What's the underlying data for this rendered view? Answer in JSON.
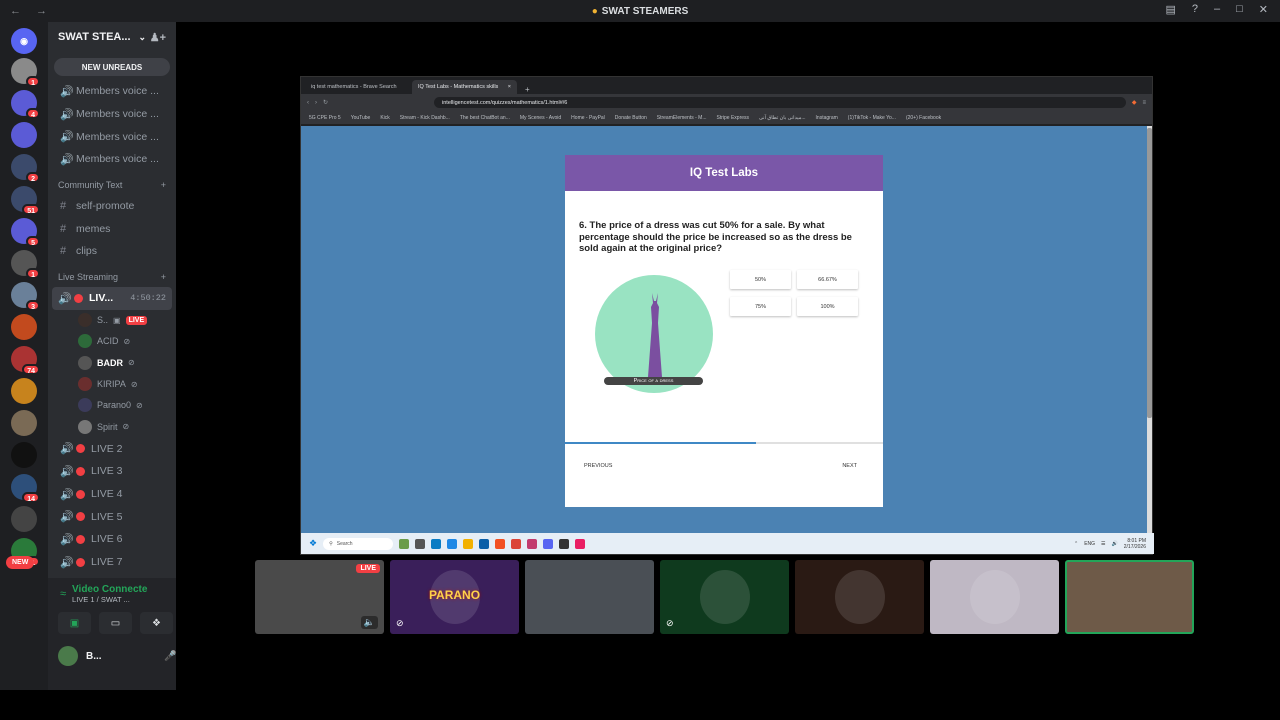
{
  "titlebar": {
    "title": "SWAT STEAMERS",
    "nav": "← →",
    "ctrl_min": "–",
    "ctrl_max": "□",
    "ctrl_close": "✕"
  },
  "servers": {
    "items": [
      {
        "badge": "1",
        "color": "#8a8a8a"
      },
      {
        "badge": "4",
        "color": "#5b5bd6"
      },
      {
        "badge": "",
        "color": "#5b5bd6"
      },
      {
        "badge": "2",
        "color": "#3b4a6b"
      },
      {
        "badge": "51",
        "color": "#3b4a6b"
      },
      {
        "badge": "5",
        "color": "#5b5bd6"
      },
      {
        "badge": "1",
        "color": "#555"
      },
      {
        "badge": "3",
        "color": "#6a8099"
      },
      {
        "badge": "",
        "color": "#c24a1e"
      },
      {
        "badge": "74",
        "color": "#a33"
      },
      {
        "badge": "",
        "color": "#c7831d"
      },
      {
        "badge": "",
        "color": "#7a6a55"
      },
      {
        "badge": "",
        "color": "#111"
      },
      {
        "badge": "14",
        "color": "#2d4f7a"
      },
      {
        "badge": "",
        "color": "#444"
      },
      {
        "badge": "11",
        "color": "#2a7a3a"
      }
    ],
    "new_label": "NEW"
  },
  "sidebar": {
    "guild_name": "SWAT STEA...",
    "new_unreads": "NEW UNREADS",
    "voice_channels_top": [
      "Members voice ...",
      "Members voice ...",
      "Members voice ...",
      "Members voice ..."
    ],
    "category_text": "Community Text",
    "text_channels": [
      "self-promote",
      "memes",
      "clips"
    ],
    "category_live": "Live Streaming",
    "active_channel": {
      "name": "LIV...",
      "time": "4:50:22"
    },
    "users": [
      {
        "name": "S..",
        "live": "LIVE"
      },
      {
        "name": "ACID"
      },
      {
        "name": "BADR"
      },
      {
        "name": "KIRIPA"
      },
      {
        "name": "Parano0"
      },
      {
        "name": "Spirit"
      }
    ],
    "live_channels": [
      "LIVE 2",
      "LIVE 3",
      "LIVE 4",
      "LIVE 5",
      "LIVE 6",
      "LIVE 7"
    ]
  },
  "voice_panel": {
    "title": "Video Connecte",
    "subtitle": "LIVE 1 / SWAT ...",
    "user": "B..."
  },
  "browser": {
    "tabs": [
      {
        "label": "iq test mathematics - Brave Search"
      },
      {
        "label": "IQ Test Labs - Mathematics skills"
      }
    ],
    "url": "intelligencetest.com/quizzes/mathematics/1.html#/6",
    "bookmarks": [
      "5G CPE Pro 5",
      "YouTube",
      "Kick",
      "Stream - Kick Dashb...",
      "The best ChatBot an...",
      "My Scenes - Avoid",
      "Home - PayPal",
      "Donate Button",
      "StreamElements - M...",
      "Stripe Express",
      "میدانی بان تطاق آنی...",
      "Instagram",
      "(1)TikTok - Make Yo...",
      "(20+) Facebook"
    ]
  },
  "quiz": {
    "header": "IQ Test Labs",
    "question": "6. The price of a dress was cut 50% for a sale. By what percentage should the price be increased so as the dress be sold again at the original price?",
    "illustration_caption": "Price of a dress",
    "options": [
      "50%",
      "66.67%",
      "75%",
      "100%"
    ],
    "progress": 0.6,
    "previous": "PREVIOUS",
    "next": "NEXT"
  },
  "taskbar": {
    "search": "Search",
    "lang": "ENG",
    "time": "8:01 PM",
    "date": "2/17/2026"
  },
  "tiles": [
    {
      "kind": "screen",
      "badge": "LIVE",
      "color": "#4a4a4a"
    },
    {
      "kind": "avatar",
      "label": "PARANO",
      "color": "#3a1f5a"
    },
    {
      "kind": "camera",
      "color": "#4a4f55"
    },
    {
      "kind": "avatar",
      "color": "#0f3a1e"
    },
    {
      "kind": "avatar",
      "color": "#2a1a14"
    },
    {
      "kind": "avatar",
      "color": "#bfb8c4"
    },
    {
      "kind": "camera",
      "color": "#6e5a48"
    }
  ]
}
